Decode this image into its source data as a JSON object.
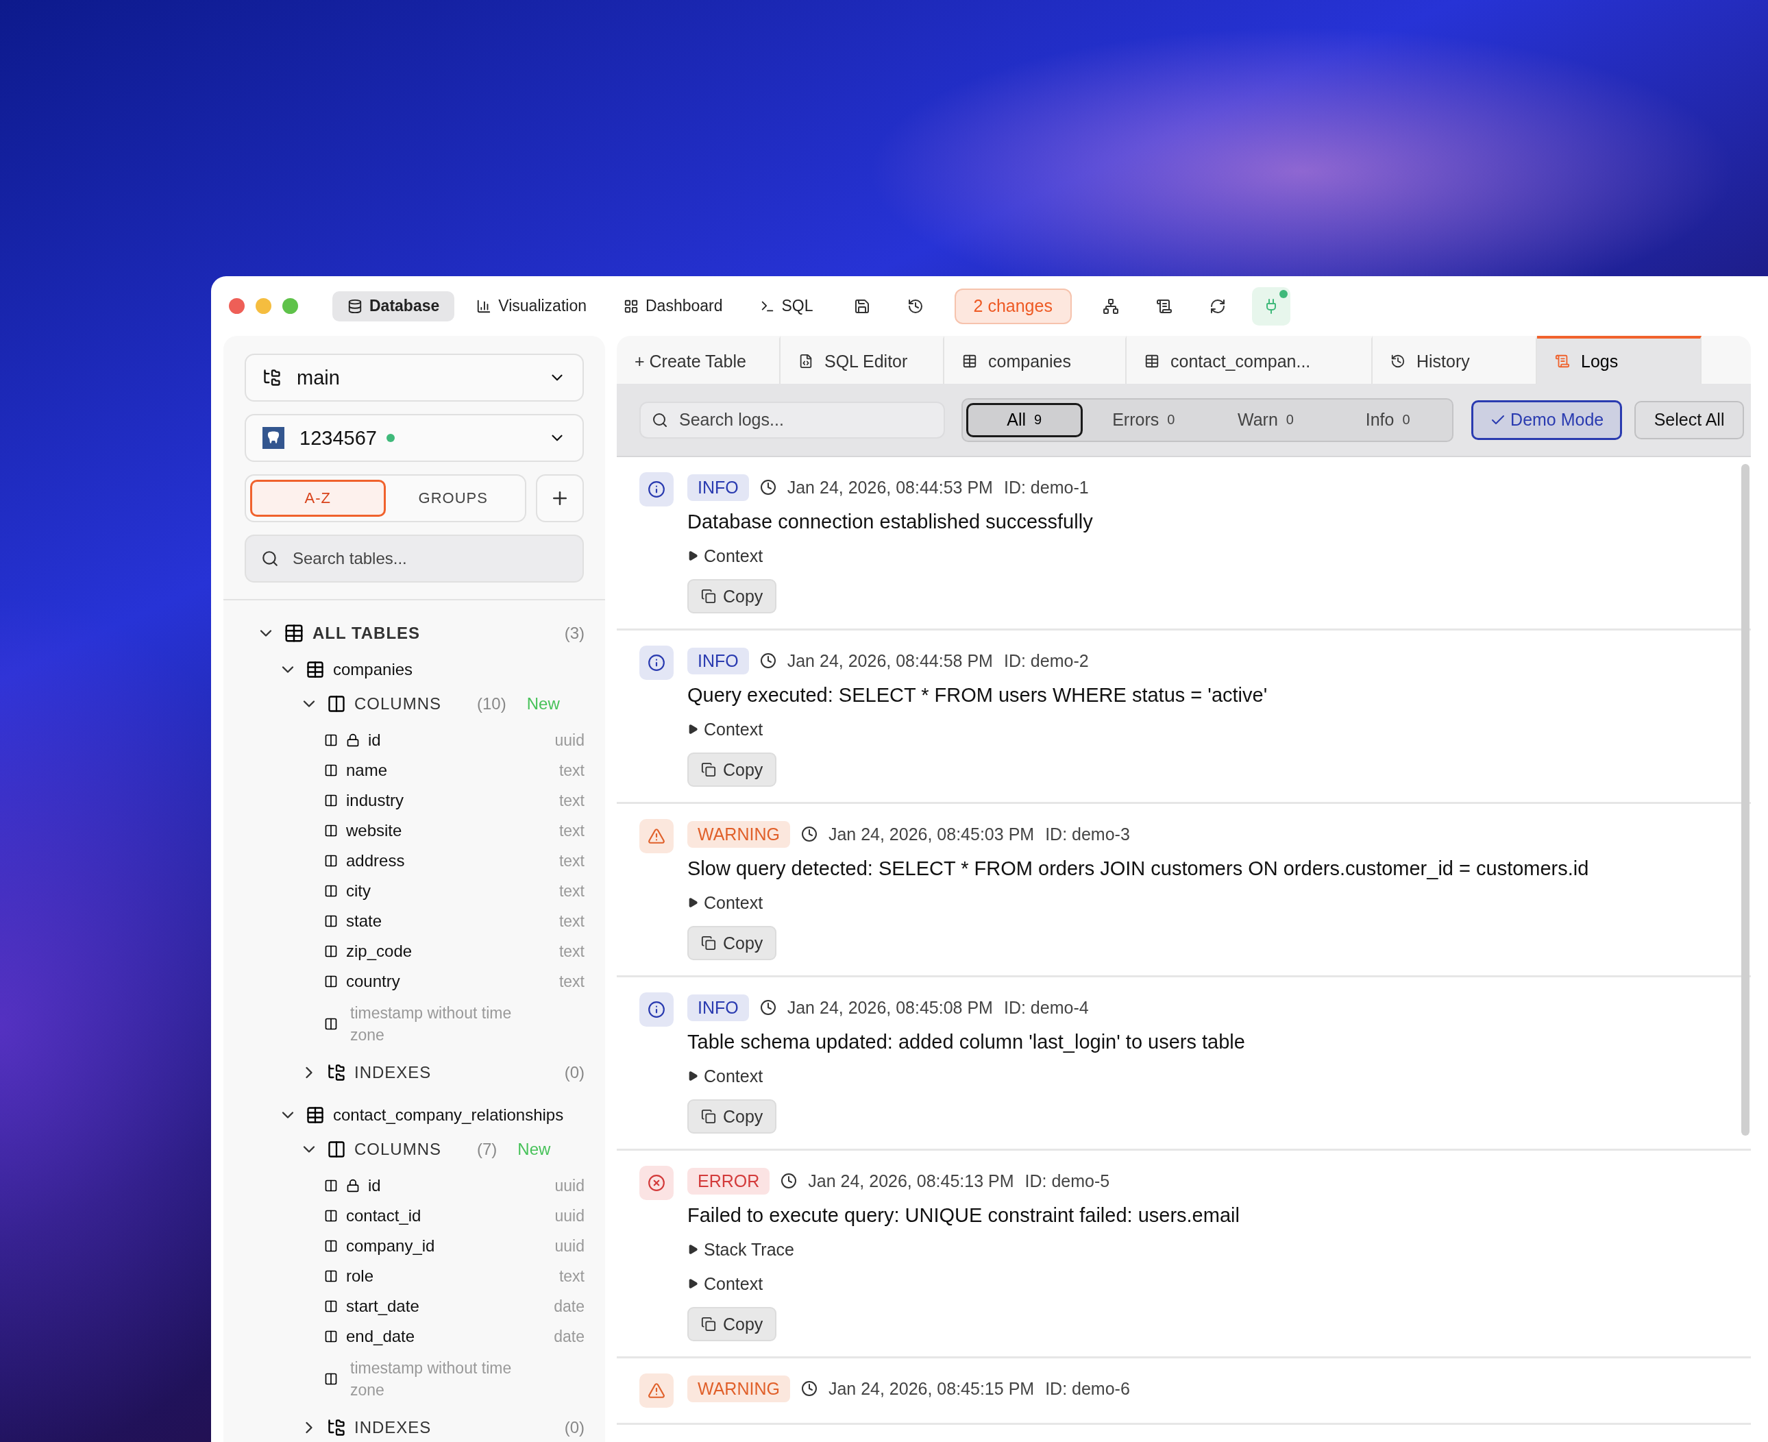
{
  "toolbar": {
    "nav": [
      {
        "kind": "database",
        "label": "Database",
        "selected": true
      },
      {
        "kind": "chart",
        "label": "Visualization",
        "selected": false
      },
      {
        "kind": "dashboard",
        "label": "Dashboard",
        "selected": false
      },
      {
        "kind": "sql",
        "label": "SQL",
        "selected": false
      }
    ],
    "changes": "2 changes",
    "plug_connected": true
  },
  "sidebar": {
    "branch": "main",
    "connection": {
      "name": "1234567",
      "online": true
    },
    "sort_tabs": [
      {
        "label": "A-Z",
        "selected": true
      },
      {
        "label": "GROUPS",
        "selected": false
      }
    ],
    "search": {
      "placeholder": "Search tables..."
    },
    "tree": {
      "label": "ALL TABLES",
      "count": "(3)",
      "expanded": true,
      "children": [
        {
          "name": "companies",
          "expanded": true,
          "children": [
            {
              "kind": "columns",
              "label": "COLUMNS",
              "count": "(10)",
              "badge": "New",
              "expanded": true,
              "children": [
                {
                  "name": "id",
                  "type": "uuid",
                  "primary": true
                },
                {
                  "name": "name",
                  "type": "text",
                  "primary": false
                },
                {
                  "name": "industry",
                  "type": "text",
                  "primary": false
                },
                {
                  "name": "website",
                  "type": "text",
                  "primary": false
                },
                {
                  "name": "address",
                  "type": "text",
                  "primary": false
                },
                {
                  "name": "city",
                  "type": "text",
                  "primary": false
                },
                {
                  "name": "state",
                  "type": "text",
                  "primary": false
                },
                {
                  "name": "zip_code",
                  "type": "text",
                  "primary": false
                },
                {
                  "name": "country",
                  "type": "text",
                  "primary": false
                },
                {
                  "type": "timestamp without time zone",
                  "primary": false
                }
              ]
            },
            {
              "kind": "indexes",
              "label": "INDEXES",
              "count": "(0)",
              "expanded": false
            }
          ]
        },
        {
          "name": "contact_company_relationships",
          "expanded": true,
          "children": [
            {
              "kind": "columns",
              "label": "COLUMNS",
              "count": "(7)",
              "badge": "New",
              "expanded": true,
              "children": [
                {
                  "name": "id",
                  "type": "uuid",
                  "primary": true
                },
                {
                  "name": "contact_id",
                  "type": "uuid",
                  "primary": false
                },
                {
                  "name": "company_id",
                  "type": "uuid",
                  "primary": false
                },
                {
                  "name": "role",
                  "type": "text",
                  "primary": false
                },
                {
                  "name": "start_date",
                  "type": "date",
                  "primary": false
                },
                {
                  "name": "end_date",
                  "type": "date",
                  "primary": false
                },
                {
                  "type": "timestamp without time zone",
                  "primary": false
                }
              ]
            },
            {
              "kind": "indexes",
              "label": "INDEXES",
              "count": "(0)",
              "expanded": false
            }
          ]
        }
      ]
    }
  },
  "tabs": [
    {
      "kind": "create",
      "label": "+ Create Table",
      "selected": false
    },
    {
      "kind": "sql",
      "label": "SQL Editor",
      "selected": false
    },
    {
      "kind": "table",
      "label": "companies",
      "selected": false
    },
    {
      "kind": "table",
      "label": "contact_compan...",
      "selected": false
    },
    {
      "kind": "history",
      "label": "History",
      "selected": false
    },
    {
      "kind": "logs",
      "label": "Logs",
      "selected": true
    }
  ],
  "logs_toolbar": {
    "search": {
      "placeholder": "Search logs..."
    },
    "filters": [
      {
        "label": "All",
        "count": "9",
        "selected": true
      },
      {
        "label": "Errors",
        "count": "0",
        "selected": false
      },
      {
        "label": "Warn",
        "count": "0",
        "selected": false
      },
      {
        "label": "Info",
        "count": "0",
        "selected": false
      }
    ],
    "demo_mode": {
      "label": "Demo Mode",
      "checked": true
    },
    "select_all": "Select All"
  },
  "logs": [
    {
      "kind": "info",
      "severity": "INFO",
      "time": "Jan 24, 2026, 08:44:53 PM",
      "id": "ID: demo-1",
      "message": "Database connection established successfully",
      "details": [
        {
          "label": "Context",
          "expanded": false
        }
      ],
      "copy": "Copy"
    },
    {
      "kind": "info",
      "severity": "INFO",
      "time": "Jan 24, 2026, 08:44:58 PM",
      "id": "ID: demo-2",
      "message": "Query executed: SELECT * FROM users WHERE status = 'active'",
      "details": [
        {
          "label": "Context",
          "expanded": false
        }
      ],
      "copy": "Copy"
    },
    {
      "kind": "warning",
      "severity": "WARNING",
      "time": "Jan 24, 2026, 08:45:03 PM",
      "id": "ID: demo-3",
      "message": "Slow query detected: SELECT * FROM orders JOIN customers ON orders.customer_id = customers.id",
      "details": [
        {
          "label": "Context",
          "expanded": false
        }
      ],
      "copy": "Copy"
    },
    {
      "kind": "info",
      "severity": "INFO",
      "time": "Jan 24, 2026, 08:45:08 PM",
      "id": "ID: demo-4",
      "message": "Table schema updated: added column 'last_login' to users table",
      "details": [
        {
          "label": "Context",
          "expanded": false
        }
      ],
      "copy": "Copy"
    },
    {
      "kind": "error",
      "severity": "ERROR",
      "time": "Jan 24, 2026, 08:45:13 PM",
      "id": "ID: demo-5",
      "message": "Failed to execute query: UNIQUE constraint failed: users.email",
      "details": [
        {
          "label": "Stack Trace",
          "expanded": false
        },
        {
          "label": "Context",
          "expanded": false
        }
      ],
      "copy": "Copy"
    },
    {
      "kind": "warning",
      "severity": "WARNING",
      "time": "Jan 24, 2026, 08:45:15 PM",
      "id": "ID: demo-6"
    }
  ]
}
